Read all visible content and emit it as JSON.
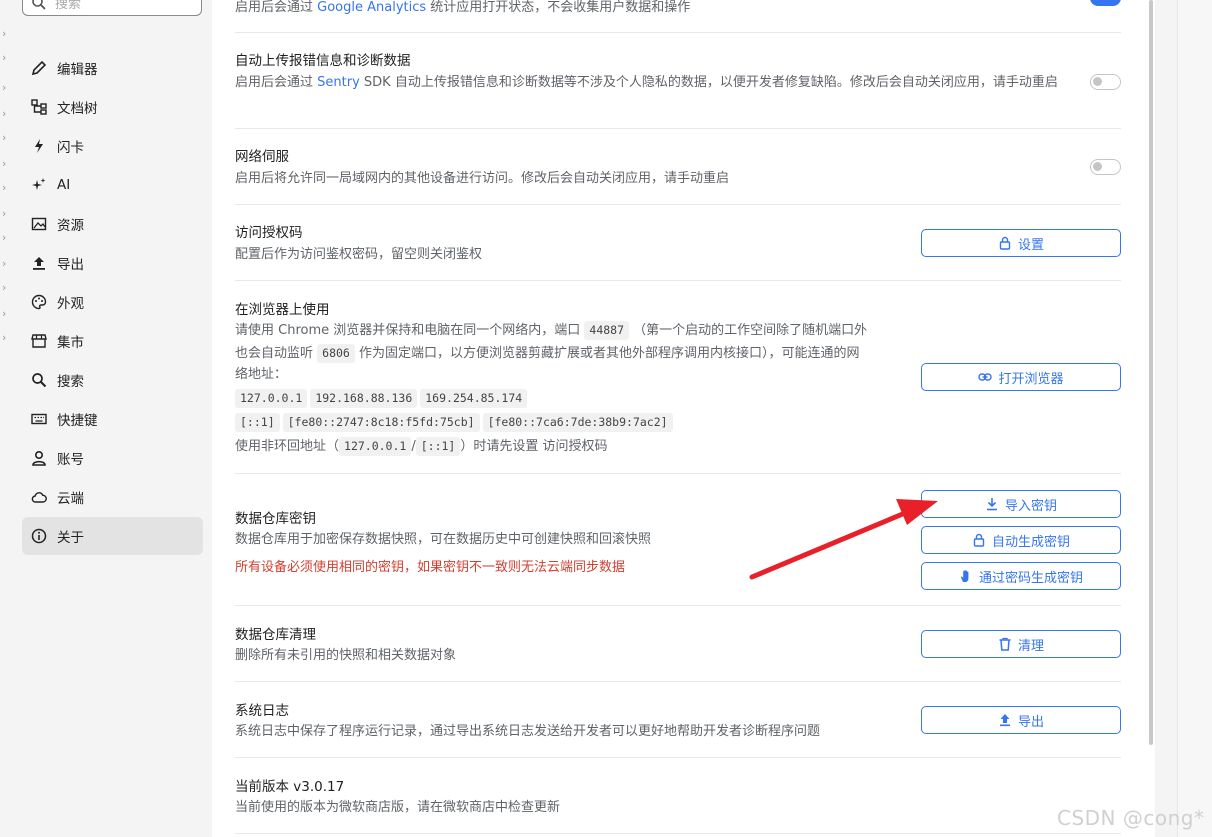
{
  "sidebar": {
    "search_placeholder": "搜索",
    "items": [
      {
        "label": "编辑器",
        "icon": "pencil-icon"
      },
      {
        "label": "文档树",
        "icon": "tree-icon"
      },
      {
        "label": "闪卡",
        "icon": "flash-icon"
      },
      {
        "label": "AI",
        "icon": "sparkle-icon"
      },
      {
        "label": "资源",
        "icon": "image-icon"
      },
      {
        "label": "导出",
        "icon": "upload-icon"
      },
      {
        "label": "外观",
        "icon": "palette-icon"
      },
      {
        "label": "集市",
        "icon": "store-icon"
      },
      {
        "label": "搜索",
        "icon": "search-icon"
      },
      {
        "label": "快捷键",
        "icon": "keyboard-icon"
      },
      {
        "label": "账号",
        "icon": "user-icon"
      },
      {
        "label": "云端",
        "icon": "cloud-icon"
      },
      {
        "label": "关于",
        "icon": "info-icon",
        "active": true
      }
    ]
  },
  "settings": {
    "analytics": {
      "desc_pre": "启用后会通过 ",
      "desc_link": "Google Analytics",
      "desc_post": " 统计应用打开状态，不会收集用户数据和操作",
      "enabled": true
    },
    "error_report": {
      "title": "自动上传报错信息和诊断数据",
      "desc_pre": "启用后会通过 ",
      "desc_link": "Sentry",
      "desc_post": " SDK 自动上传报错信息和诊断数据等不涉及个人隐私的数据，以便开发者修复缺陷。修改后会自动关闭应用，请手动重启",
      "enabled": false
    },
    "network_serve": {
      "title": "网络伺服",
      "desc": "启用后将允许同一局域网内的其他设备进行访问。修改后会自动关闭应用，请手动重启",
      "enabled": false
    },
    "access_code": {
      "title": "访问授权码",
      "desc": "配置后作为访问鉴权密码，留空则关闭鉴权",
      "button": "设置"
    },
    "browser": {
      "title": "在浏览器上使用",
      "desc1": "请使用 Chrome 浏览器并保持和电脑在同一个网络内，端口",
      "port": "44887",
      "desc2": "（第一个启动的工作空间除了随机端口外",
      "desc3": "也会自动监听",
      "fixed_port": "6806",
      "desc4": "作为固定端口，以方便浏览器剪藏扩展或者其他外部程序调用内核接口），可能连通的网",
      "desc5": "络地址：",
      "addresses_row1": [
        "127.0.0.1",
        "192.168.88.136",
        "169.254.85.174"
      ],
      "addresses_row2": [
        "[::1]",
        "[fe80::2747:8c18:f5fd:75cb]",
        "[fe80::7ca6:7de:38b9:7ac2]"
      ],
      "note_pre": "使用非环回地址（",
      "note_addr1": "127.0.0.1",
      "note_sep": "/",
      "note_addr2": "[::1]",
      "note_post": "）时请先设置 访问授权码",
      "button": "打开浏览器"
    },
    "repo_key": {
      "title": "数据仓库密钥",
      "desc": "数据仓库用于加密保存数据快照，可在数据历史中可创建快照和回滚快照",
      "warning": "所有设备必须使用相同的密钥，如果密钥不一致则无法云端同步数据",
      "buttons": [
        "导入密钥",
        "自动生成密钥",
        "通过密码生成密钥"
      ]
    },
    "repo_purge": {
      "title": "数据仓库清理",
      "desc": "删除所有未引用的快照和相关数据对象",
      "button": "清理"
    },
    "syslog": {
      "title": "系统日志",
      "desc": "系统日志中保存了程序运行记录，通过导出系统日志发送给开发者可以更好地帮助开发者诊断程序问题",
      "button": "导出"
    },
    "version": {
      "title": "当前版本 v3.0.17",
      "desc": "当前使用的版本为微软商店版，请在微软商店中检查更新"
    }
  },
  "watermark": "CSDN @cong*",
  "colors": {
    "accent": "#3575f0",
    "warning": "#d23f31",
    "arrow": "#e8202a"
  }
}
